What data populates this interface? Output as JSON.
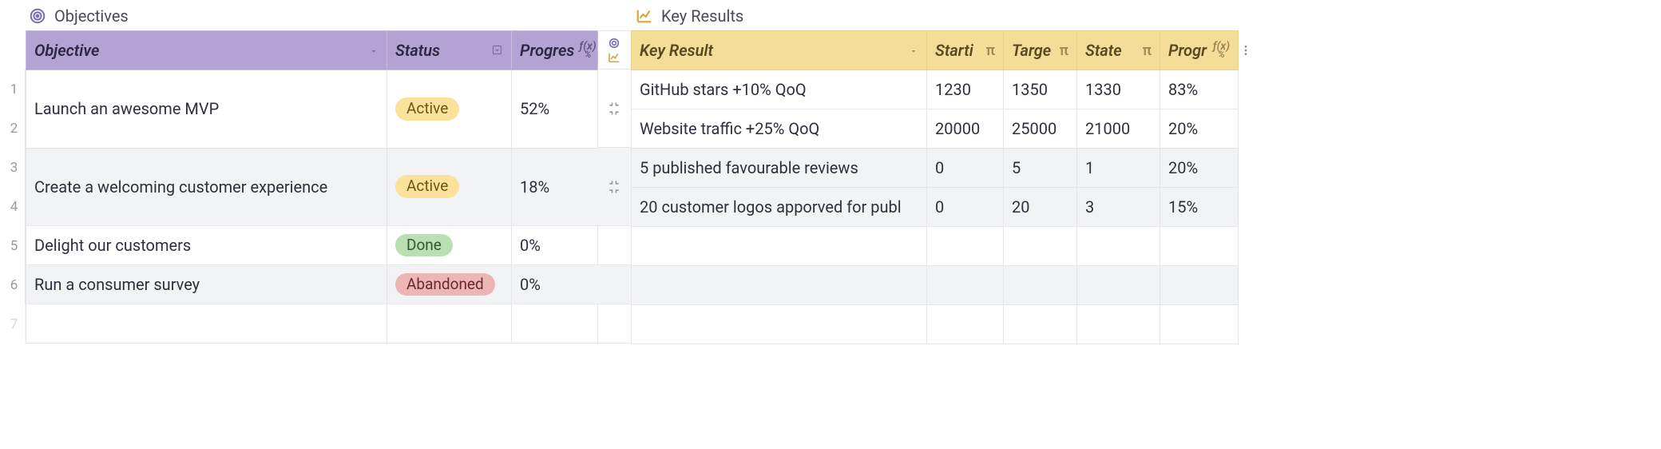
{
  "objectives_section": {
    "title": "Objectives",
    "columns": {
      "objective": "Objective",
      "status": "Status",
      "progress": "Progres"
    },
    "rows": [
      {
        "objective": "Launch an awesome MVP",
        "status": "Active",
        "status_kind": "active",
        "progress": "52%",
        "span": 2
      },
      {
        "objective": "Create a welcoming customer experience",
        "status": "Active",
        "status_kind": "active",
        "progress": "18%",
        "span": 2
      },
      {
        "objective": "Delight our customers",
        "status": "Done",
        "status_kind": "done",
        "progress": "0%",
        "span": 1
      },
      {
        "objective": "Run a consumer survey",
        "status": "Abandoned",
        "status_kind": "abandoned",
        "progress": "0%",
        "span": 1
      }
    ],
    "row_numbers": [
      "1",
      "2",
      "3",
      "4",
      "5",
      "6",
      "7"
    ]
  },
  "keyresults_section": {
    "title": "Key Results",
    "columns": {
      "key_result": "Key Result",
      "starting": "Starti",
      "target": "Targe",
      "state": "State",
      "progress": "Progr"
    },
    "rows": [
      {
        "key_result": "GitHub stars +10% QoQ",
        "starting": "1230",
        "target": "1350",
        "state": "1330",
        "progress": "83%"
      },
      {
        "key_result": "Website traffic +25% QoQ",
        "starting": "20000",
        "target": "25000",
        "state": "21000",
        "progress": "20%"
      },
      {
        "key_result": "5 published favourable reviews",
        "starting": "0",
        "target": "5",
        "state": "1",
        "progress": "20%"
      },
      {
        "key_result": "20 customer logos apporved for publ",
        "starting": "0",
        "target": "20",
        "state": "3",
        "progress": "15%"
      }
    ]
  },
  "icons": {
    "target": "target-icon",
    "chart": "chart-line-icon",
    "dropdown": "chevron-down-icon",
    "collapse": "collapse-icon",
    "pi": "π",
    "fx_top": "ƒ(x)",
    "fx_bot": "%"
  }
}
